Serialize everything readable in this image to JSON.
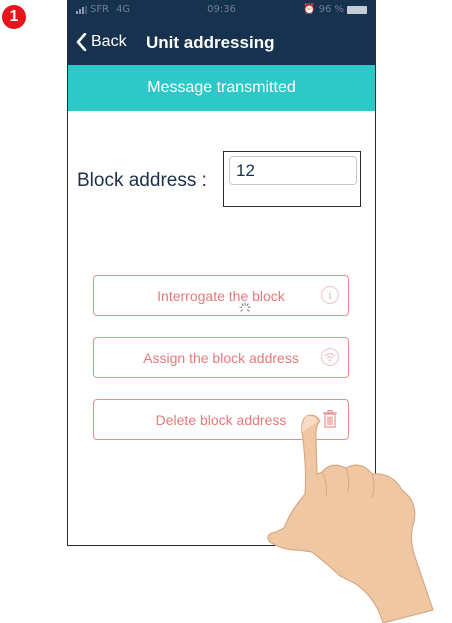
{
  "step_number": "1",
  "status_bar": {
    "carrier": "SFR",
    "network": "4G",
    "time": "09:36",
    "battery": "96 %"
  },
  "navbar": {
    "back_label": "Back",
    "title": "Unit addressing"
  },
  "banner": {
    "message": "Message transmitted"
  },
  "form": {
    "label": "Block address :",
    "value": "12"
  },
  "buttons": {
    "interrogate": {
      "label": "Interrogate the block",
      "icon": "info-icon"
    },
    "assign": {
      "label": "Assign the block address",
      "icon": "wifi-icon"
    },
    "delete": {
      "label": "Delete block address",
      "icon": "trash-icon"
    }
  },
  "colors": {
    "navbar": "#17324f",
    "banner": "#2ec8c9",
    "button_text": "#e8787a",
    "badge": "#e8141b"
  }
}
